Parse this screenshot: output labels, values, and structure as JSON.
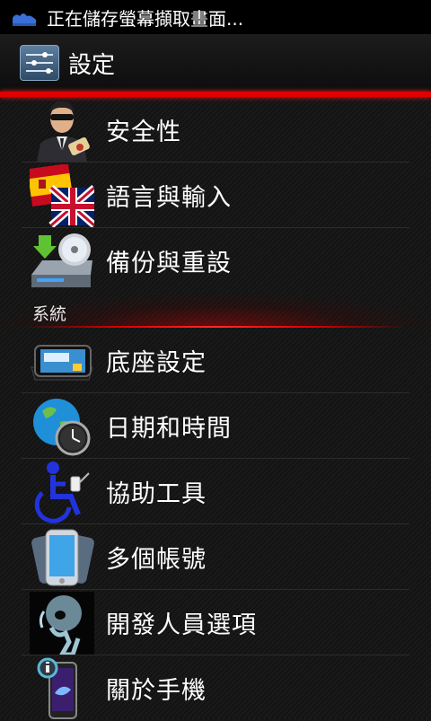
{
  "status_bar": {
    "text": "正在儲存螢幕擷取畫面...",
    "icon": "screenshot-notification-icon"
  },
  "action_bar": {
    "title": "設定",
    "icon": "settings-sliders-icon"
  },
  "colors": {
    "accent": "#e00000",
    "background": "#141414",
    "text": "#ffffff"
  },
  "items_top": [
    {
      "label": "安全性",
      "icon": "security-agent-icon"
    },
    {
      "label": "語言與輸入",
      "icon": "language-flags-icon"
    },
    {
      "label": "備份與重設",
      "icon": "backup-drive-icon"
    }
  ],
  "section": {
    "title": "系統"
  },
  "items_system": [
    {
      "label": "底座設定",
      "icon": "dock-phone-icon"
    },
    {
      "label": "日期和時間",
      "icon": "globe-clock-icon"
    },
    {
      "label": "協助工具",
      "icon": "accessibility-wheelchair-icon"
    },
    {
      "label": "多個帳號",
      "icon": "multiple-accounts-phones-icon"
    },
    {
      "label": "開發人員選項",
      "icon": "developer-xray-icon"
    },
    {
      "label": "關於手機",
      "icon": "about-phone-icon"
    }
  ]
}
